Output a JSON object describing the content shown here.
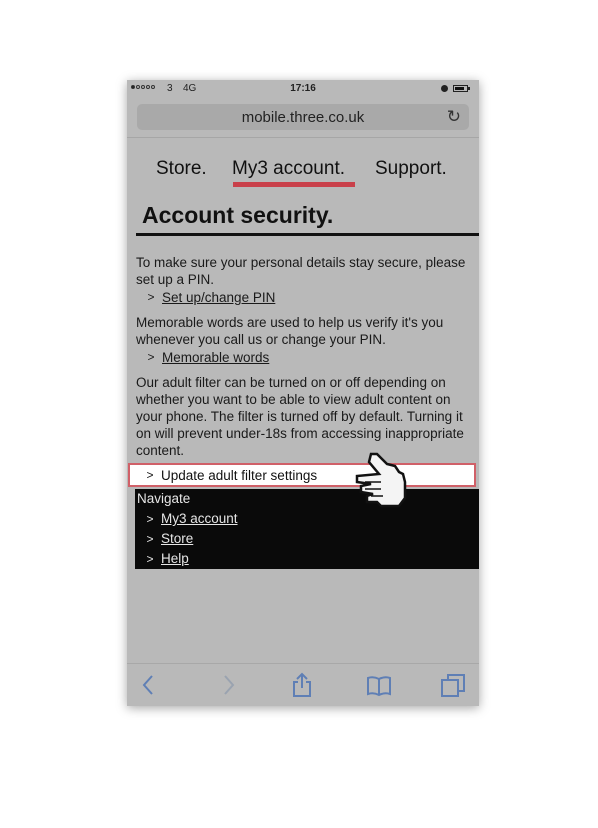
{
  "status_bar": {
    "carrier": "3",
    "network": "4G",
    "time": "17:16",
    "signal_bars_filled": 1,
    "signal_bars_total": 5
  },
  "browser": {
    "url": "mobile.three.co.uk",
    "reload_icon": "reload-icon"
  },
  "top_nav": {
    "items": [
      {
        "label": "Store."
      },
      {
        "label": "My3 account.",
        "active": true
      },
      {
        "label": "Support."
      }
    ],
    "active_color": "#c9404a"
  },
  "page": {
    "title": "Account security.",
    "sections": [
      {
        "text": "To make sure your personal details stay secure, please set up a PIN.",
        "link": "Set up/change PIN"
      },
      {
        "text": "Memorable words are used to help us verify it's you whenever you call us or change your PIN.",
        "link": "Memorable words"
      },
      {
        "text": "Our adult filter can be turned on or off depending on whether you want to be able to view adult content on your phone. The filter is turned off by default. Turning it on will prevent under-18s from accessing inappropriate content.",
        "link": "Update adult filter settings"
      }
    ],
    "chevron": ">"
  },
  "navigate": {
    "heading": "Navigate",
    "links": [
      "My3 account",
      "Store",
      "Help"
    ]
  },
  "toolbar": {
    "items": [
      "back-icon",
      "forward-icon",
      "share-icon",
      "bookmarks-icon",
      "tabs-icon"
    ],
    "accent": "#5f7fb5"
  },
  "highlight_color": "#d06068"
}
